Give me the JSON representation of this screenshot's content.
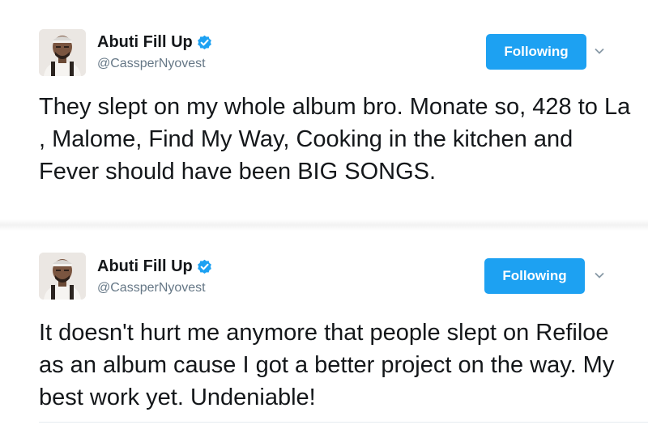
{
  "tweets": [
    {
      "author_name": "Abuti Fill Up",
      "handle": "@CassperNyovest",
      "verified": true,
      "follow_label": "Following",
      "text": "They slept on my whole album bro. Monate so, 428 to La , Malome, Find My Way, Cooking in the kitchen and Fever should have been BIG SONGS."
    },
    {
      "author_name": "Abuti Fill Up",
      "handle": "@CassperNyovest",
      "verified": true,
      "follow_label": "Following",
      "text": "It doesn't hurt me anymore that people slept on Refiloe as an album cause I got a better project on the way. My best work yet. Undeniable!"
    }
  ],
  "colors": {
    "accent": "#1da1f2",
    "text": "#14171a",
    "muted": "#657786"
  },
  "icons": {
    "verified": "verified-badge-icon",
    "chevron": "chevron-down-icon"
  }
}
